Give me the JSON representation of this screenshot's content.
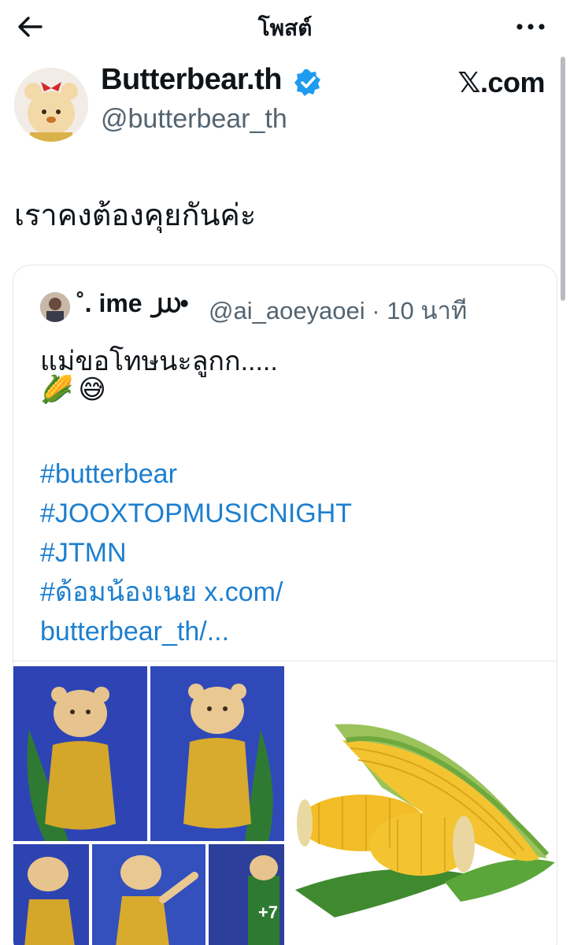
{
  "topbar": {
    "title": "โพสต์",
    "back_icon": "arrow-left-icon",
    "more_icon": "more-horizontal-icon"
  },
  "post": {
    "author_name": "Butterbear.th",
    "author_handle": "@butterbear_th",
    "verified_icon": "verified-badge-icon",
    "source_label": "𝕏.com",
    "text": "เราคงต้องคุยกันค่ะ"
  },
  "quote": {
    "name": "˚. ime ൰•",
    "handle_time": "@ai_aoeyaoei · 10 นาที",
    "text": "แม่ขอโทษนะลูกก.....",
    "emoji": "🌽😅",
    "hashtags": [
      "#butterbear",
      "#JOOXTOPMUSICNIGHT",
      "#JTMN",
      "#ด้อมน้องเนย x.com/",
      "butterbear_th/..."
    ],
    "media_more_count": "+7"
  },
  "colors": {
    "link": "#1d7fcf",
    "verified": "#1d9bf0",
    "muted": "#536471"
  }
}
